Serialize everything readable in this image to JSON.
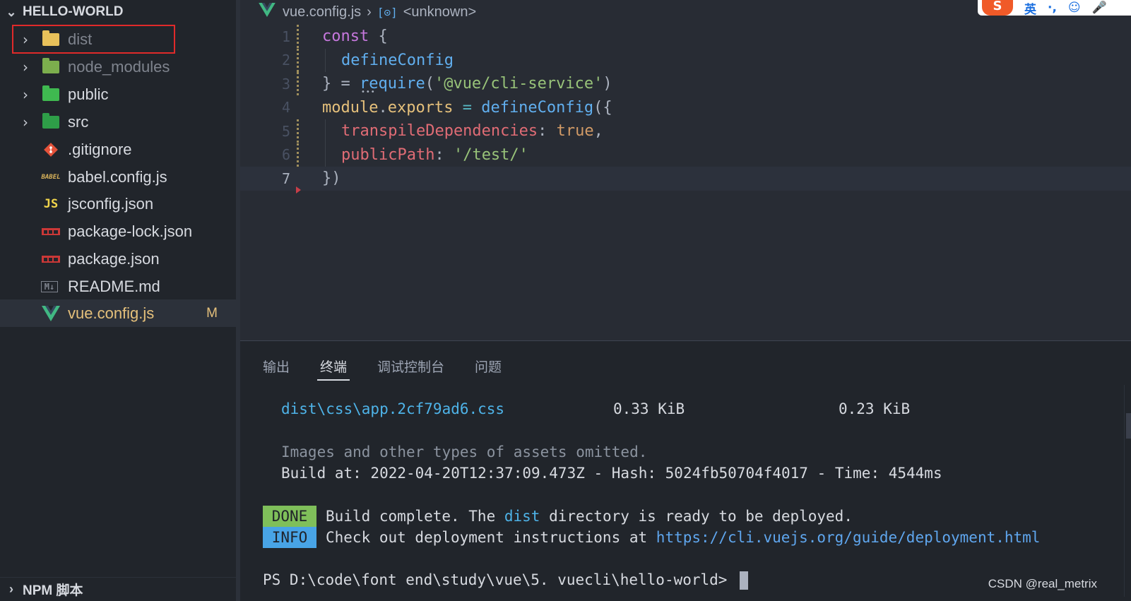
{
  "explorer": {
    "title": "HELLO-WORLD",
    "items": [
      {
        "name": "dist",
        "type": "folder",
        "icon": "dist-folder-icon"
      },
      {
        "name": "node_modules",
        "type": "folder",
        "icon": "node-modules-folder-icon"
      },
      {
        "name": "public",
        "type": "folder",
        "icon": "public-folder-icon"
      },
      {
        "name": "src",
        "type": "folder",
        "icon": "src-folder-icon"
      },
      {
        "name": ".gitignore",
        "type": "file",
        "icon": "git-icon"
      },
      {
        "name": "babel.config.js",
        "type": "file",
        "icon": "babel-icon",
        "icon_text": "BABEL"
      },
      {
        "name": "jsconfig.json",
        "type": "file",
        "icon": "js-icon",
        "icon_text": "JS"
      },
      {
        "name": "package-lock.json",
        "type": "file",
        "icon": "npm-icon"
      },
      {
        "name": "package.json",
        "type": "file",
        "icon": "npm-icon"
      },
      {
        "name": "README.md",
        "type": "file",
        "icon": "markdown-icon",
        "icon_text": "M↓"
      },
      {
        "name": "vue.config.js",
        "type": "file",
        "icon": "vue-icon",
        "git_status": "M"
      }
    ],
    "npm_section": "NPM 脚本"
  },
  "breadcrumb": {
    "file": "vue.config.js",
    "symbol": "<unknown>"
  },
  "editor": {
    "line_numbers": [
      "1",
      "2",
      "3",
      "4",
      "5",
      "6",
      "7"
    ],
    "current_line": "7",
    "tokens": {
      "l1_kw": "const",
      "l1_brace": " {",
      "l2_fn": "defineConfig",
      "l3_close": "} = ",
      "l3_fn": "require",
      "l3_open": "(",
      "l3_str": "'@vue/cli-service'",
      "l3_close2": ")",
      "l4_mod": "module",
      "l4_dot": ".",
      "l4_exp": "exports",
      "l4_eq": " = ",
      "l4_fn": "defineConfig",
      "l4_open": "({",
      "l5_prop": "transpileDependencies",
      "l5_colon": ": ",
      "l5_bool": "true",
      "l5_comma": ",",
      "l6_prop": "publicPath",
      "l6_colon": ": ",
      "l6_str": "'/test/'",
      "l7": "})"
    }
  },
  "ime": {
    "logo": "S",
    "items": [
      "英",
      "·,",
      "☺",
      "🎤"
    ]
  },
  "panel": {
    "tabs": [
      "输出",
      "终端",
      "调试控制台",
      "问题"
    ],
    "active_tab": "终端",
    "terminal": {
      "asset_file": "dist\\css\\app.2cf79ad6.css",
      "asset_size": "0.33 KiB",
      "asset_gzip": "0.23 KiB",
      "omitted": "Images and other types of assets omitted.",
      "build_info": "Build at: 2022-04-20T12:37:09.473Z - Hash: 5024fb50704f4017 - Time: 4544ms",
      "done_badge": "DONE",
      "done_pre": "Build complete. The ",
      "done_dir": "dist",
      "done_post": " directory is ready to be deployed.",
      "info_badge": "INFO",
      "info_pre": "Check out deployment instructions at ",
      "info_url": "https://cli.vuejs.org/guide/deployment.html",
      "prompt": "PS D:\\code\\font end\\study\\vue\\5. vuecli\\hello-world> "
    }
  },
  "watermark": "CSDN @real_metrix"
}
